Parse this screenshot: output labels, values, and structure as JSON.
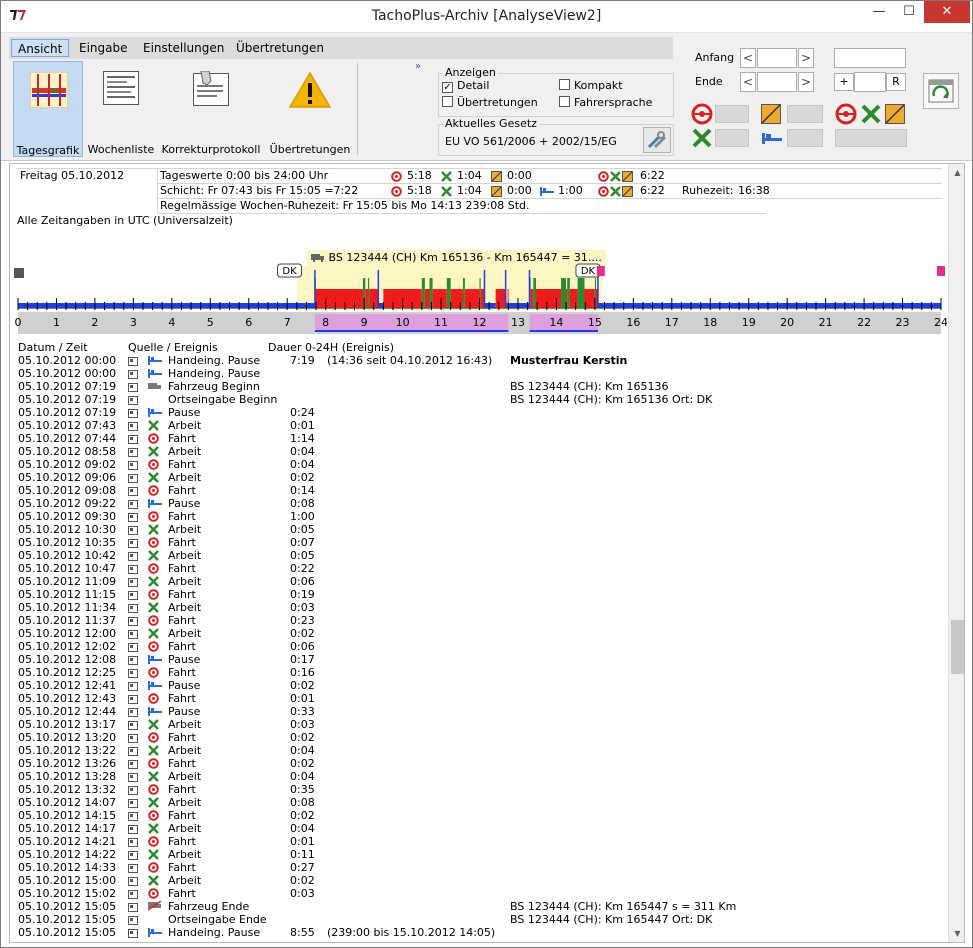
{
  "window": {
    "title": "TachoPlus-Archiv [AnalyseView2]",
    "controls": {
      "minimize": "—",
      "maximize": "☐",
      "close": "✕"
    }
  },
  "menu": {
    "items": [
      "Ansicht",
      "Eingabe",
      "Einstellungen",
      "Übertretungen"
    ],
    "active": "Ansicht"
  },
  "toolbar": {
    "tools": [
      {
        "label": "Tagesgrafik",
        "icon": "daily-chart-icon",
        "active": true
      },
      {
        "label": "Wochenliste",
        "icon": "weekly-list-icon",
        "active": false
      },
      {
        "label": "Korrekturprotokoll",
        "icon": "correction-protocol-icon",
        "active": false
      },
      {
        "label": "Übertretungen",
        "icon": "warning-icon",
        "active": false
      }
    ],
    "expand": "»"
  },
  "anzeigen": {
    "title": "Anzeigen",
    "options": [
      {
        "label": "Detail",
        "checked": true
      },
      {
        "label": "Kompakt",
        "checked": false
      },
      {
        "label": "Übertretungen",
        "checked": false
      },
      {
        "label": "Fahrersprache",
        "checked": false
      }
    ]
  },
  "law": {
    "title": "Aktuelles Gesetz",
    "value": "EU VO 561/2006 + 2002/15/EG"
  },
  "range": {
    "start_label": "Anfang",
    "end_label": "Ende",
    "prev": "<",
    "next": ">",
    "plus": "+",
    "reset": "R"
  },
  "summary": {
    "date": "Freitag 05.10.2012",
    "row1": {
      "label": "Tageswerte 0:00 bis 24:00 Uhr",
      "drive": "5:18",
      "work": "1:04",
      "avail": "0:00",
      "total": "6:22"
    },
    "row2": {
      "label": "Schicht: Fr 07:43 bis Fr 15:05 =7:22",
      "drive": "5:18",
      "work": "1:04",
      "avail": "0:00",
      "rest": "1:00",
      "total": "6:22",
      "rest_label": "Ruhezeit:",
      "rest_value": "16:38"
    },
    "row3": "Regelmässige Wochen-Ruhezeit: Fr 15:05 bis Mo 14:13  239:08 Std.",
    "utc_note": "Alle Zeitangaben in UTC (Universalzeit)"
  },
  "timeline": {
    "vehicle_label": "BS 123444 (CH) Km 165136 - Km 165447 = 31....",
    "place_start": "DK",
    "place_end": "DK",
    "hours": [
      "0",
      "1",
      "2",
      "3",
      "4",
      "5",
      "6",
      "7",
      "8",
      "9",
      "10",
      "11",
      "12",
      "13",
      "14",
      "15",
      "16",
      "17",
      "18",
      "19",
      "20",
      "21",
      "22",
      "23",
      "24"
    ],
    "colors": {
      "rest": "#1f3fe0",
      "drive": "#ee1c1c",
      "work": "#2f8a2f",
      "highlight": "#fbf6c4",
      "shift": "#dda0dd"
    },
    "segments": [
      {
        "type": "rest",
        "start": 0.0,
        "end": 7.72
      },
      {
        "type": "work",
        "start": 7.72,
        "end": 7.73
      },
      {
        "type": "drive",
        "start": 7.73,
        "end": 8.97
      },
      {
        "type": "work",
        "start": 8.97,
        "end": 9.03
      },
      {
        "type": "drive",
        "start": 9.03,
        "end": 9.1
      },
      {
        "type": "work",
        "start": 9.1,
        "end": 9.13
      },
      {
        "type": "drive",
        "start": 9.13,
        "end": 9.37
      },
      {
        "type": "rest",
        "start": 9.37,
        "end": 9.5
      },
      {
        "type": "drive",
        "start": 9.5,
        "end": 10.5
      },
      {
        "type": "work",
        "start": 10.5,
        "end": 10.58
      },
      {
        "type": "drive",
        "start": 10.58,
        "end": 10.7
      },
      {
        "type": "work",
        "start": 10.7,
        "end": 10.78
      },
      {
        "type": "drive",
        "start": 10.78,
        "end": 11.15
      },
      {
        "type": "work",
        "start": 11.15,
        "end": 11.25
      },
      {
        "type": "drive",
        "start": 11.25,
        "end": 11.57
      },
      {
        "type": "work",
        "start": 11.57,
        "end": 11.62
      },
      {
        "type": "drive",
        "start": 11.62,
        "end": 12.0
      },
      {
        "type": "work",
        "start": 12.0,
        "end": 12.03
      },
      {
        "type": "drive",
        "start": 12.03,
        "end": 12.13
      },
      {
        "type": "rest",
        "start": 12.13,
        "end": 12.42
      },
      {
        "type": "drive",
        "start": 12.42,
        "end": 12.68
      },
      {
        "type": "rest",
        "start": 12.68,
        "end": 12.73
      },
      {
        "type": "drive",
        "start": 12.73,
        "end": 12.75
      },
      {
        "type": "rest",
        "start": 12.75,
        "end": 13.3
      },
      {
        "type": "work",
        "start": 13.3,
        "end": 13.33
      },
      {
        "type": "drive",
        "start": 13.33,
        "end": 13.4
      },
      {
        "type": "work",
        "start": 13.4,
        "end": 13.47
      },
      {
        "type": "drive",
        "start": 13.47,
        "end": 14.12
      },
      {
        "type": "work",
        "start": 14.12,
        "end": 14.25
      },
      {
        "type": "drive",
        "start": 14.25,
        "end": 14.28
      },
      {
        "type": "work",
        "start": 14.28,
        "end": 14.35
      },
      {
        "type": "drive",
        "start": 14.35,
        "end": 14.55
      },
      {
        "type": "work",
        "start": 14.55,
        "end": 14.73
      },
      {
        "type": "drive",
        "start": 14.73,
        "end": 15.0
      },
      {
        "type": "work",
        "start": 15.0,
        "end": 15.03
      },
      {
        "type": "drive",
        "start": 15.03,
        "end": 15.08
      },
      {
        "type": "rest",
        "start": 15.08,
        "end": 24.0
      }
    ],
    "shift_bars": [
      {
        "start": 7.72,
        "end": 12.75
      },
      {
        "start": 13.3,
        "end": 15.08
      }
    ]
  },
  "log": {
    "headers": {
      "date": "Datum / Zeit",
      "source": "Quelle / Ereignis",
      "duration": "Dauer 0-24H  (Ereignis)"
    },
    "driver": "Musterfrau Kerstin",
    "rows": [
      {
        "date": "05.10.2012 00:00",
        "icon": "rest",
        "event": "Handeing. Pause",
        "dur": "7:19",
        "extra": "(14:36 seit 04.10.2012 16:43)",
        "note": ""
      },
      {
        "date": "05.10.2012 00:00",
        "icon": "rest",
        "event": "Handeing. Pause",
        "dur": "",
        "extra": "",
        "note": ""
      },
      {
        "date": "05.10.2012 07:19",
        "icon": "vehicle",
        "event": "Fahrzeug Beginn",
        "dur": "",
        "extra": "",
        "note": "BS 123444 (CH): Km 165136"
      },
      {
        "date": "05.10.2012 07:19",
        "icon": "none",
        "event": "Ortseingabe Beginn",
        "dur": "",
        "extra": "",
        "note": "BS 123444 (CH): Km 165136  Ort: DK"
      },
      {
        "date": "05.10.2012 07:19",
        "icon": "rest",
        "event": "Pause",
        "dur": "0:24",
        "extra": "",
        "note": ""
      },
      {
        "date": "05.10.2012 07:43",
        "icon": "work",
        "event": "Arbeit",
        "dur": "0:01",
        "extra": "",
        "note": ""
      },
      {
        "date": "05.10.2012 07:44",
        "icon": "drive",
        "event": "Fahrt",
        "dur": "1:14",
        "extra": "",
        "note": ""
      },
      {
        "date": "05.10.2012 08:58",
        "icon": "work",
        "event": "Arbeit",
        "dur": "0:04",
        "extra": "",
        "note": ""
      },
      {
        "date": "05.10.2012 09:02",
        "icon": "drive",
        "event": "Fahrt",
        "dur": "0:04",
        "extra": "",
        "note": ""
      },
      {
        "date": "05.10.2012 09:06",
        "icon": "work",
        "event": "Arbeit",
        "dur": "0:02",
        "extra": "",
        "note": ""
      },
      {
        "date": "05.10.2012 09:08",
        "icon": "drive",
        "event": "Fahrt",
        "dur": "0:14",
        "extra": "",
        "note": ""
      },
      {
        "date": "05.10.2012 09:22",
        "icon": "rest",
        "event": "Pause",
        "dur": "0:08",
        "extra": "",
        "note": ""
      },
      {
        "date": "05.10.2012 09:30",
        "icon": "drive",
        "event": "Fahrt",
        "dur": "1:00",
        "extra": "",
        "note": ""
      },
      {
        "date": "05.10.2012 10:30",
        "icon": "work",
        "event": "Arbeit",
        "dur": "0:05",
        "extra": "",
        "note": ""
      },
      {
        "date": "05.10.2012 10:35",
        "icon": "drive",
        "event": "Fahrt",
        "dur": "0:07",
        "extra": "",
        "note": ""
      },
      {
        "date": "05.10.2012 10:42",
        "icon": "work",
        "event": "Arbeit",
        "dur": "0:05",
        "extra": "",
        "note": ""
      },
      {
        "date": "05.10.2012 10:47",
        "icon": "drive",
        "event": "Fahrt",
        "dur": "0:22",
        "extra": "",
        "note": ""
      },
      {
        "date": "05.10.2012 11:09",
        "icon": "work",
        "event": "Arbeit",
        "dur": "0:06",
        "extra": "",
        "note": ""
      },
      {
        "date": "05.10.2012 11:15",
        "icon": "drive",
        "event": "Fahrt",
        "dur": "0:19",
        "extra": "",
        "note": ""
      },
      {
        "date": "05.10.2012 11:34",
        "icon": "work",
        "event": "Arbeit",
        "dur": "0:03",
        "extra": "",
        "note": ""
      },
      {
        "date": "05.10.2012 11:37",
        "icon": "drive",
        "event": "Fahrt",
        "dur": "0:23",
        "extra": "",
        "note": ""
      },
      {
        "date": "05.10.2012 12:00",
        "icon": "work",
        "event": "Arbeit",
        "dur": "0:02",
        "extra": "",
        "note": ""
      },
      {
        "date": "05.10.2012 12:02",
        "icon": "drive",
        "event": "Fahrt",
        "dur": "0:06",
        "extra": "",
        "note": ""
      },
      {
        "date": "05.10.2012 12:08",
        "icon": "rest",
        "event": "Pause",
        "dur": "0:17",
        "extra": "",
        "note": ""
      },
      {
        "date": "05.10.2012 12:25",
        "icon": "drive",
        "event": "Fahrt",
        "dur": "0:16",
        "extra": "",
        "note": ""
      },
      {
        "date": "05.10.2012 12:41",
        "icon": "rest",
        "event": "Pause",
        "dur": "0:02",
        "extra": "",
        "note": ""
      },
      {
        "date": "05.10.2012 12:43",
        "icon": "drive",
        "event": "Fahrt",
        "dur": "0:01",
        "extra": "",
        "note": ""
      },
      {
        "date": "05.10.2012 12:44",
        "icon": "rest",
        "event": "Pause",
        "dur": "0:33",
        "extra": "",
        "note": ""
      },
      {
        "date": "05.10.2012 13:17",
        "icon": "work",
        "event": "Arbeit",
        "dur": "0:03",
        "extra": "",
        "note": ""
      },
      {
        "date": "05.10.2012 13:20",
        "icon": "drive",
        "event": "Fahrt",
        "dur": "0:02",
        "extra": "",
        "note": ""
      },
      {
        "date": "05.10.2012 13:22",
        "icon": "work",
        "event": "Arbeit",
        "dur": "0:04",
        "extra": "",
        "note": ""
      },
      {
        "date": "05.10.2012 13:26",
        "icon": "drive",
        "event": "Fahrt",
        "dur": "0:02",
        "extra": "",
        "note": ""
      },
      {
        "date": "05.10.2012 13:28",
        "icon": "work",
        "event": "Arbeit",
        "dur": "0:04",
        "extra": "",
        "note": ""
      },
      {
        "date": "05.10.2012 13:32",
        "icon": "drive",
        "event": "Fahrt",
        "dur": "0:35",
        "extra": "",
        "note": ""
      },
      {
        "date": "05.10.2012 14:07",
        "icon": "work",
        "event": "Arbeit",
        "dur": "0:08",
        "extra": "",
        "note": ""
      },
      {
        "date": "05.10.2012 14:15",
        "icon": "drive",
        "event": "Fahrt",
        "dur": "0:02",
        "extra": "",
        "note": ""
      },
      {
        "date": "05.10.2012 14:17",
        "icon": "work",
        "event": "Arbeit",
        "dur": "0:04",
        "extra": "",
        "note": ""
      },
      {
        "date": "05.10.2012 14:21",
        "icon": "drive",
        "event": "Fahrt",
        "dur": "0:01",
        "extra": "",
        "note": ""
      },
      {
        "date": "05.10.2012 14:22",
        "icon": "work",
        "event": "Arbeit",
        "dur": "0:11",
        "extra": "",
        "note": ""
      },
      {
        "date": "05.10.2012 14:33",
        "icon": "drive",
        "event": "Fahrt",
        "dur": "0:27",
        "extra": "",
        "note": ""
      },
      {
        "date": "05.10.2012 15:00",
        "icon": "work",
        "event": "Arbeit",
        "dur": "0:02",
        "extra": "",
        "note": ""
      },
      {
        "date": "05.10.2012 15:02",
        "icon": "drive",
        "event": "Fahrt",
        "dur": "0:03",
        "extra": "",
        "note": ""
      },
      {
        "date": "05.10.2012 15:05",
        "icon": "vehicle-end",
        "event": "Fahrzeug Ende",
        "dur": "",
        "extra": "",
        "note": "BS 123444 (CH): Km 165447  s = 311 Km"
      },
      {
        "date": "05.10.2012 15:05",
        "icon": "none",
        "event": "Ortseingabe Ende",
        "dur": "",
        "extra": "",
        "note": "BS 123444 (CH): Km 165447  Ort: DK"
      },
      {
        "date": "05.10.2012 15:05",
        "icon": "rest",
        "event": "Handeing. Pause",
        "dur": "8:55",
        "extra": "(239:00 bis 15.10.2012 14:05)",
        "note": ""
      }
    ]
  }
}
